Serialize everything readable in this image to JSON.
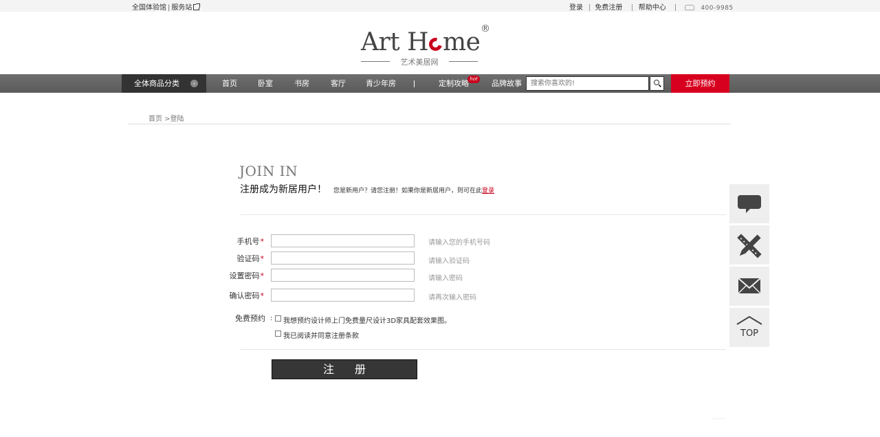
{
  "topbar": {
    "experience_store": "全国体验馆",
    "service_station": "服务站",
    "login": "登录",
    "register": "免费注册",
    "help": "帮助中心",
    "phone": "400-9985"
  },
  "logo": {
    "art": "Art H",
    "me": "me",
    "reg": "®",
    "sub": "艺术美居网"
  },
  "nav": {
    "all_categories": "全体商品分类",
    "items": [
      "首页",
      "卧室",
      "书房",
      "客厅",
      "青少年房",
      "定制攻略",
      "品牌故事"
    ],
    "hot": "hot",
    "search_placeholder": "搜索你喜欢的!",
    "book": "立即预约"
  },
  "breadcrumb": "首页 >登陆",
  "join": {
    "title": "JOIN IN",
    "subtitle": "注册成为新居用户！",
    "hint": "您是新用户？请您注册！如果你是新居用户，则可在此",
    "login_link": "登录"
  },
  "form": {
    "phone_label": "手机号",
    "code_label": "验证码",
    "password_label": "设置密码",
    "confirm_label": "确认密码",
    "required_mark": "*",
    "phone_hint": "请输入您的手机号码",
    "code_hint": "请输入验证码",
    "password_hint": "请输入密码",
    "confirm_hint": "请再次输入密码",
    "free_booking_label": "免费预约",
    "booking_option": "我想预约设计师上门免费量尺设计3D家具配套效果图。",
    "agree_option": "我已阅读并同意注册条款",
    "submit": "注册"
  },
  "side": {
    "top": "TOP"
  }
}
